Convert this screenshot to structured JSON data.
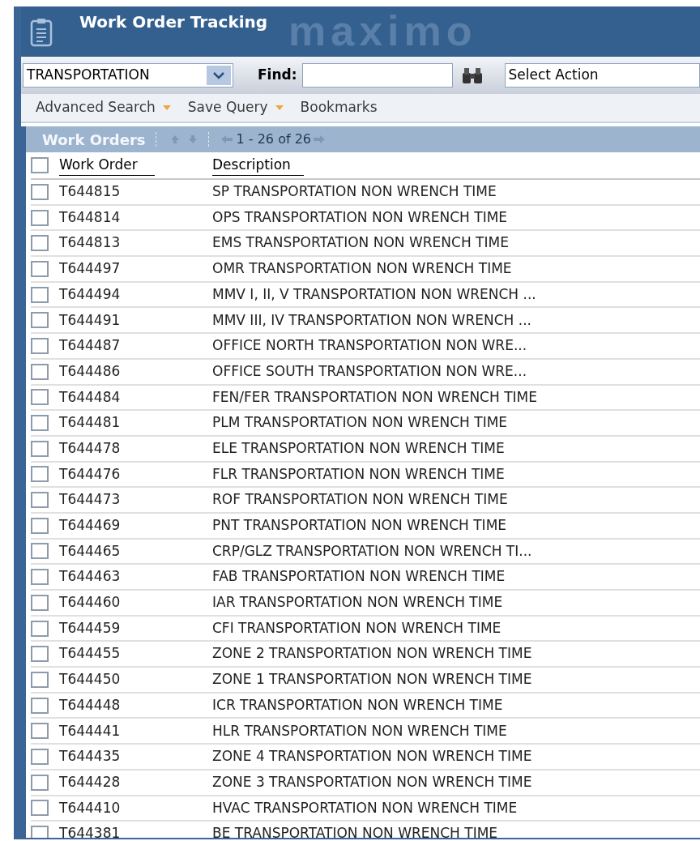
{
  "window": {
    "title": "Work Order Tracking",
    "brand": "maximo"
  },
  "toolbar": {
    "query": "TRANSPORTATION",
    "find_label": "Find:",
    "action": "Select Action"
  },
  "menu": [
    {
      "label": "Advanced Search",
      "dropdown": true
    },
    {
      "label": "Save Query",
      "dropdown": true
    },
    {
      "label": "Bookmarks",
      "dropdown": false
    }
  ],
  "table": {
    "title": "Work Orders",
    "pager": "1 - 26 of 26",
    "select_all_checked": false,
    "columns": [
      "Work Order",
      "Description"
    ],
    "rows": [
      {
        "checked": false,
        "cells": [
          "T644815",
          "SP TRANSPORTATION NON WRENCH TIME"
        ]
      },
      {
        "checked": false,
        "cells": [
          "T644814",
          "OPS TRANSPORTATION NON WRENCH TIME"
        ]
      },
      {
        "checked": false,
        "cells": [
          "T644813",
          "EMS TRANSPORTATION NON WRENCH TIME"
        ]
      },
      {
        "checked": false,
        "cells": [
          "T644497",
          "OMR TRANSPORTATION NON WRENCH TIME"
        ]
      },
      {
        "checked": false,
        "cells": [
          "T644494",
          "MMV I, II, V TRANSPORTATION NON WRENCH ..."
        ]
      },
      {
        "checked": false,
        "cells": [
          "T644491",
          "MMV III, IV TRANSPORTATION NON WRENCH ..."
        ]
      },
      {
        "checked": false,
        "cells": [
          "T644487",
          "OFFICE NORTH TRANSPORTATION NON WRE..."
        ]
      },
      {
        "checked": false,
        "cells": [
          "T644486",
          "OFFICE SOUTH TRANSPORTATION NON WRE..."
        ]
      },
      {
        "checked": false,
        "cells": [
          "T644484",
          "FEN/FER TRANSPORTATION NON WRENCH TIME"
        ]
      },
      {
        "checked": false,
        "cells": [
          "T644481",
          "PLM TRANSPORTATION NON WRENCH TIME"
        ]
      },
      {
        "checked": false,
        "cells": [
          "T644478",
          "ELE TRANSPORTATION NON WRENCH TIME"
        ]
      },
      {
        "checked": false,
        "cells": [
          "T644476",
          "FLR TRANSPORTATION NON WRENCH TIME"
        ]
      },
      {
        "checked": false,
        "cells": [
          "T644473",
          "ROF TRANSPORTATION NON WRENCH TIME"
        ]
      },
      {
        "checked": false,
        "cells": [
          "T644469",
          "PNT TRANSPORTATION NON WRENCH TIME"
        ]
      },
      {
        "checked": false,
        "cells": [
          "T644465",
          "CRP/GLZ TRANSPORTATION NON WRENCH TI..."
        ]
      },
      {
        "checked": false,
        "cells": [
          "T644463",
          "FAB TRANSPORTATION NON WRENCH TIME"
        ]
      },
      {
        "checked": false,
        "cells": [
          "T644460",
          "IAR TRANSPORTATION NON WRENCH TIME"
        ]
      },
      {
        "checked": false,
        "cells": [
          "T644459",
          "CFI TRANSPORTATION NON WRENCH TIME"
        ]
      },
      {
        "checked": false,
        "cells": [
          "T644455",
          "ZONE 2 TRANSPORTATION NON WRENCH TIME"
        ]
      },
      {
        "checked": false,
        "cells": [
          "T644450",
          "ZONE 1 TRANSPORTATION NON WRENCH TIME"
        ]
      },
      {
        "checked": false,
        "cells": [
          "T644448",
          "ICR TRANSPORTATION NON WRENCH TIME"
        ]
      },
      {
        "checked": false,
        "cells": [
          "T644441",
          "HLR TRANSPORTATION NON WRENCH TIME"
        ]
      },
      {
        "checked": false,
        "cells": [
          "T644435",
          "ZONE 4 TRANSPORTATION NON WRENCH TIME"
        ]
      },
      {
        "checked": false,
        "cells": [
          "T644428",
          "ZONE 3 TRANSPORTATION NON WRENCH TIME"
        ]
      },
      {
        "checked": false,
        "cells": [
          "T644410",
          "HVAC TRANSPORTATION NON WRENCH TIME"
        ]
      },
      {
        "checked": false,
        "cells": [
          "T644381",
          "BE TRANSPORTATION NON WRENCH TIME"
        ]
      }
    ]
  }
}
